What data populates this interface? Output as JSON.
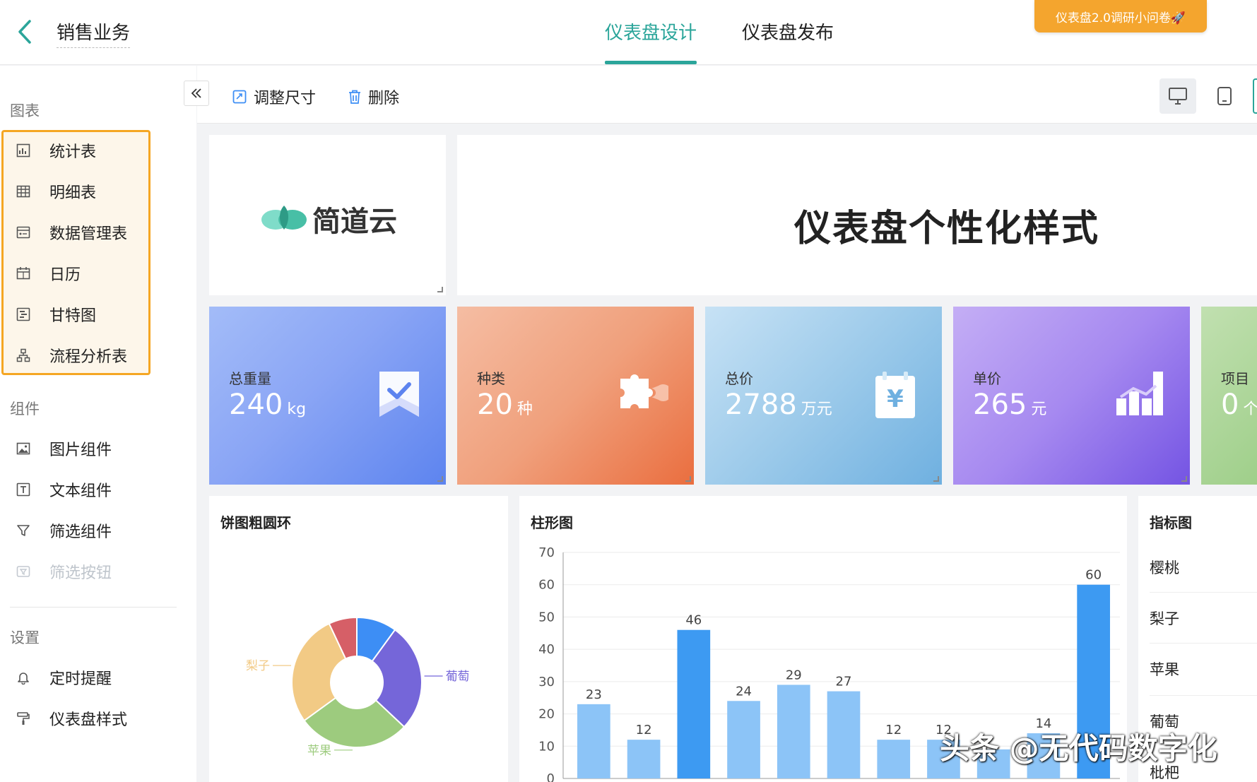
{
  "header": {
    "title": "销售业务",
    "tabs": [
      {
        "label": "仪表盘设计",
        "active": true
      },
      {
        "label": "仪表盘发布",
        "active": false
      }
    ],
    "survey_button": "仪表盘2.0调研小问卷🚀",
    "accent_color": "#2ba59a",
    "survey_color": "#f4a52e"
  },
  "sidebar": {
    "sections": {
      "charts": "图表",
      "components": "组件",
      "settings": "设置"
    },
    "chart_items": [
      {
        "label": "统计表",
        "icon": "stat-table-icon"
      },
      {
        "label": "明细表",
        "icon": "detail-table-icon"
      },
      {
        "label": "数据管理表",
        "icon": "data-manage-icon"
      },
      {
        "label": "日历",
        "icon": "calendar-icon"
      },
      {
        "label": "甘特图",
        "icon": "gantt-icon"
      },
      {
        "label": "流程分析表",
        "icon": "flow-icon"
      }
    ],
    "component_items": [
      {
        "label": "图片组件",
        "icon": "image-icon"
      },
      {
        "label": "文本组件",
        "icon": "text-icon"
      },
      {
        "label": "筛选组件",
        "icon": "filter-icon"
      },
      {
        "label": "筛选按钮",
        "icon": "filter-button-icon",
        "disabled": true
      }
    ],
    "setting_items": [
      {
        "label": "定时提醒",
        "icon": "bell-icon"
      },
      {
        "label": "仪表盘样式",
        "icon": "paint-roller-icon"
      }
    ]
  },
  "toolbar": {
    "resize": "调整尺寸",
    "delete": "删除"
  },
  "canvas": {
    "logo_text": "简道云",
    "title": "仪表盘个性化样式",
    "kpis": [
      {
        "label": "总重量",
        "value": "240",
        "unit": "kg",
        "icon": "check-flag-icon"
      },
      {
        "label": "种类",
        "value": "20",
        "unit": "种",
        "icon": "puzzle-icon"
      },
      {
        "label": "总价",
        "value": "2788",
        "unit": "万元",
        "icon": "yen-calendar-icon"
      },
      {
        "label": "单价",
        "value": "265",
        "unit": "元",
        "icon": "bar-trend-icon"
      },
      {
        "label": "项目",
        "value": "0",
        "unit": "个",
        "icon": ""
      }
    ],
    "pie_title": "饼图粗圆环",
    "bar_title": "柱形图",
    "metric_title": "指标图",
    "metric_rows": [
      "樱桃",
      "梨子",
      "苹果",
      "葡萄",
      "枇杷"
    ]
  },
  "chart_data": [
    {
      "type": "pie",
      "title": "饼图粗圆环",
      "slices": [
        {
          "name": "",
          "value": 10,
          "color": "#3d8ef5"
        },
        {
          "name": "葡萄",
          "value": 27,
          "color": "#7566d9"
        },
        {
          "name": "苹果",
          "value": 28,
          "color": "#9dcb7e"
        },
        {
          "name": "梨子",
          "value": 28,
          "color": "#f2ca85"
        },
        {
          "name": "",
          "value": 7,
          "color": "#d65f67"
        }
      ],
      "visible_labels": [
        "梨子",
        "葡萄",
        "苹果"
      ]
    },
    {
      "type": "bar",
      "title": "柱形图",
      "values": [
        23,
        12,
        46,
        24,
        29,
        27,
        12,
        12,
        9,
        14,
        60
      ],
      "data_labels": [
        "23",
        "12",
        "46",
        "24",
        "29",
        "27",
        "12",
        "12",
        "",
        "14",
        "60"
      ],
      "ylim": [
        0,
        70
      ],
      "yticks": [
        0,
        10,
        20,
        30,
        40,
        50,
        60,
        70
      ],
      "grid": true
    }
  ],
  "watermark": "头条 @无代码数字化"
}
